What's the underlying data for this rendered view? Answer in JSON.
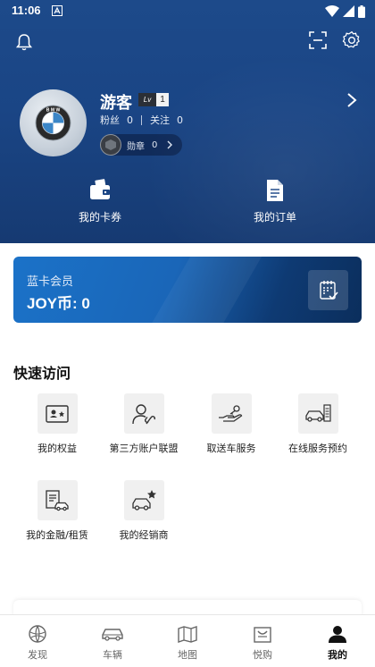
{
  "status_bar": {
    "time": "11:06"
  },
  "profile": {
    "username": "游客",
    "level_badge": "Lv",
    "level_number": "1",
    "fans_label": "粉丝",
    "fans_count": "0",
    "following_label": "关注",
    "following_count": "0",
    "medal_label": "勋章",
    "medal_count": "0"
  },
  "quick_links": [
    {
      "label": "我的卡券",
      "icon": "wallet-icon"
    },
    {
      "label": "我的订单",
      "icon": "document-icon"
    }
  ],
  "membership": {
    "title": "蓝卡会员",
    "joy_label": "JOY币:",
    "joy_value": "0"
  },
  "quick_access": {
    "title": "快速访问",
    "items": [
      {
        "label": "我的权益",
        "icon": "id-card-icon"
      },
      {
        "label": "第三方账户联盟",
        "icon": "account-link-icon"
      },
      {
        "label": "取送车服务",
        "icon": "key-handover-icon"
      },
      {
        "label": "在线服务预约",
        "icon": "car-appointment-icon"
      },
      {
        "label": "我的金融/租赁",
        "icon": "finance-icon"
      },
      {
        "label": "我的经销商",
        "icon": "dealer-star-icon"
      }
    ]
  },
  "tabbar": {
    "active": "我的",
    "tabs": [
      {
        "label": "发现",
        "icon": "discover-icon"
      },
      {
        "label": "车辆",
        "icon": "car-icon"
      },
      {
        "label": "地图",
        "icon": "map-icon"
      },
      {
        "label": "悦购",
        "icon": "shopping-bag-icon"
      },
      {
        "label": "我的",
        "icon": "profile-icon"
      }
    ]
  },
  "colors": {
    "header_blue": "#1d4a8a",
    "membership_blue": "#1b72c8",
    "membership_dark": "#0b2e5c"
  }
}
